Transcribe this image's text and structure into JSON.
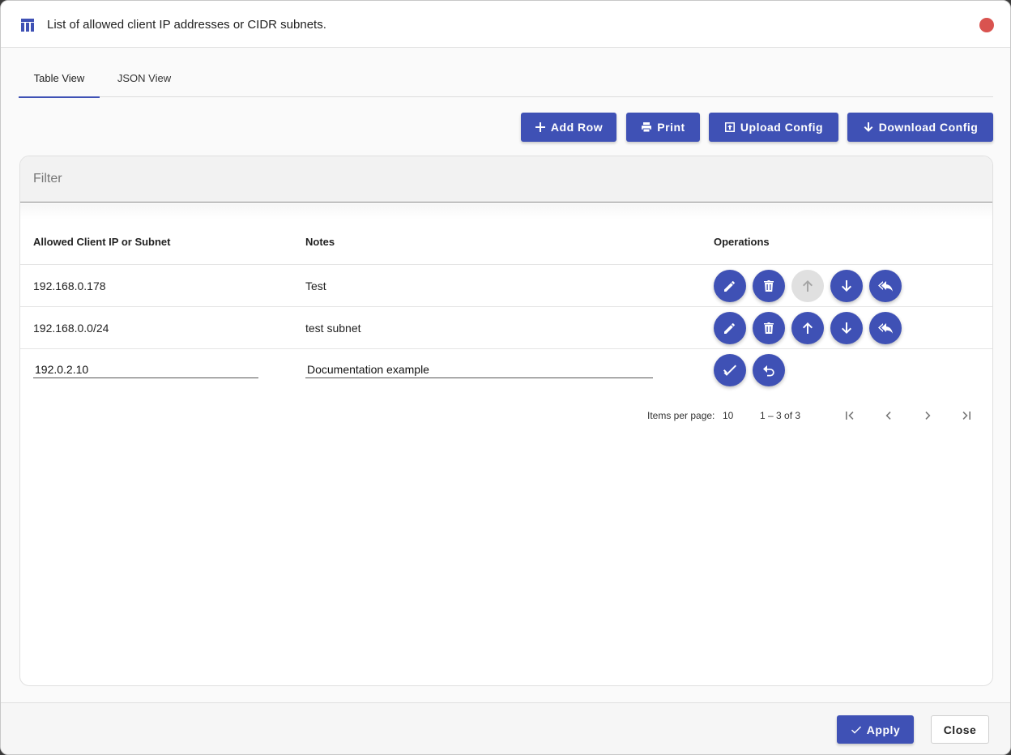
{
  "dialog": {
    "title": "List of allowed client IP addresses or CIDR subnets.",
    "icon": "table-icon",
    "close_color": "#d9534f"
  },
  "tabs": [
    {
      "label": "Table View",
      "active": true
    },
    {
      "label": "JSON View",
      "active": false
    }
  ],
  "toolbar": {
    "add_row": "Add Row",
    "print": "Print",
    "upload_config": "Upload Config",
    "download_config": "Download Config"
  },
  "filter": {
    "placeholder": "Filter",
    "value": ""
  },
  "table": {
    "columns": [
      "Allowed Client IP or Subnet",
      "Notes",
      "Operations"
    ],
    "rows": [
      {
        "ip": "192.168.0.178",
        "notes": "Test"
      },
      {
        "ip": "192.168.0.0/24",
        "notes": "test subnet"
      }
    ],
    "editing_row": {
      "ip": "192.0.2.10",
      "notes": "Documentation example"
    }
  },
  "paginator": {
    "items_per_page_label": "Items per page:",
    "items_per_page_value": "10",
    "range": "1 – 3 of 3"
  },
  "footer": {
    "apply": "Apply",
    "close": "Close"
  },
  "colors": {
    "accent": "#3f51b5"
  }
}
